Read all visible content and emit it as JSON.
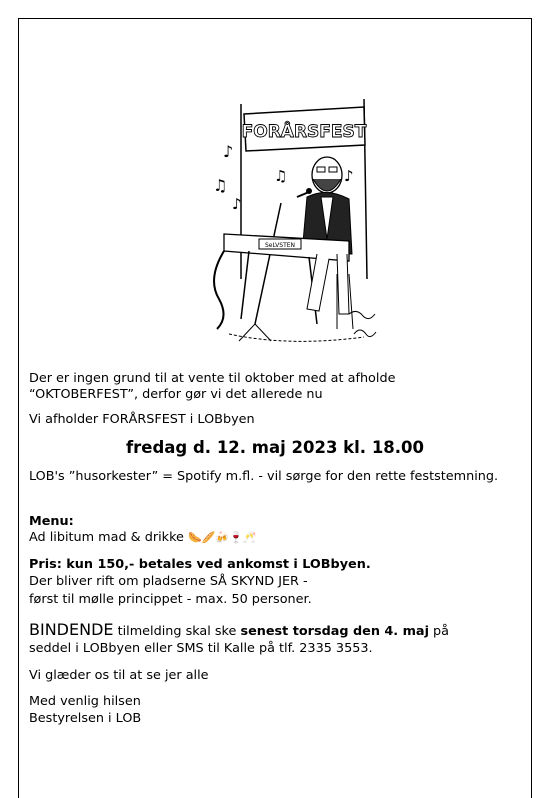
{
  "illustration": {
    "banner_text": "FORÅRSFEST",
    "keyboard_text": "SeLVSTEN"
  },
  "intro_line1": "Der er ingen grund til at vente til oktober med at afholde",
  "intro_line2": "“OKTOBERFEST”, derfor gør vi det allerede nu",
  "announce": "Vi afholder FORÅRSFEST i LOBbyen",
  "date_line": "fredag d. 12. maj 2023 kl. 18.00",
  "music_line": "LOB's ”husorkester” = Spotify m.fl. - vil sørge for den rette feststemning.",
  "menu_heading": "Menu:",
  "menu_text": "Ad libitum mad & drikke",
  "menu_emojis": "🌭🥖🍻🍷🥂",
  "price_line": "Pris: kun 150,- betales ved ankomst i LOBbyen.",
  "rush_line1": "Der bliver rift om pladserne SÅ SKYND JER -",
  "rush_line2": "først til mølle princippet - max. 50 personer.",
  "binding_word": "BINDENDE",
  "binding_mid": " tilmelding skal ske ",
  "binding_deadline": "senest torsdag den 4. maj",
  "binding_end": " på",
  "binding_line2": "seddel i LOBbyen eller SMS til Kalle på tlf. 2335 3553.",
  "look_forward": "Vi glæder os til at se jer alle",
  "greeting": "Med venlig hilsen",
  "signature": "Bestyrelsen i LOB"
}
